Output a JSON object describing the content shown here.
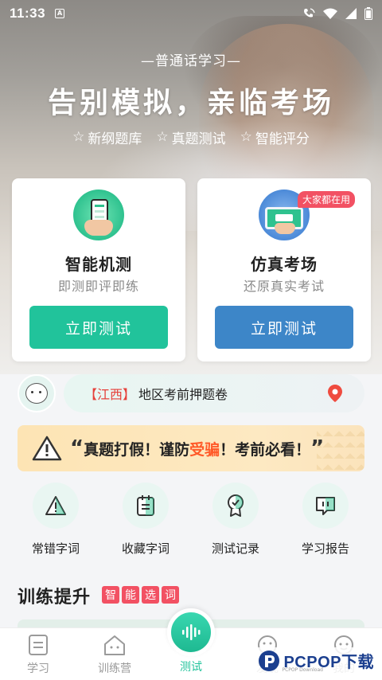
{
  "status_bar": {
    "time": "11:33"
  },
  "hero": {
    "kicker": "—普通话学习—",
    "title": "告别模拟，亲临考场",
    "tags": [
      "新纲题库",
      "真题测试",
      "智能评分"
    ]
  },
  "cards": [
    {
      "title": "智能机测",
      "subtitle": "即测即评即练",
      "button": "立即测试",
      "color": "#21c39b"
    },
    {
      "title": "仿真考场",
      "subtitle": "还原真实考试",
      "button": "立即测试",
      "badge": "大家都在用",
      "color": "#3d86c8"
    }
  ],
  "region": {
    "name": "【江西】",
    "text": "地区考前押题卷"
  },
  "warning": {
    "open": "“",
    "part1": "真题打假！谨防",
    "part2": "受骗",
    "part3": "！考前必看！",
    "close": "”"
  },
  "tools": [
    {
      "label": "常错字词",
      "icon": "warning-icon"
    },
    {
      "label": "收藏字词",
      "icon": "notebook-icon"
    },
    {
      "label": "测试记录",
      "icon": "medal-icon"
    },
    {
      "label": "学习报告",
      "icon": "report-icon"
    }
  ],
  "section": {
    "title": "训练提升",
    "chips": [
      "智",
      "能",
      "选",
      "词"
    ]
  },
  "nav": [
    {
      "label": "学习",
      "active": false
    },
    {
      "label": "训练营",
      "active": false
    },
    {
      "label": "测试",
      "active": true
    },
    {
      "label": "发现",
      "active": false
    },
    {
      "label": "我的",
      "active": false
    }
  ],
  "watermark": {
    "text": "PCPOP下载",
    "sub": "PCPOP Download"
  }
}
